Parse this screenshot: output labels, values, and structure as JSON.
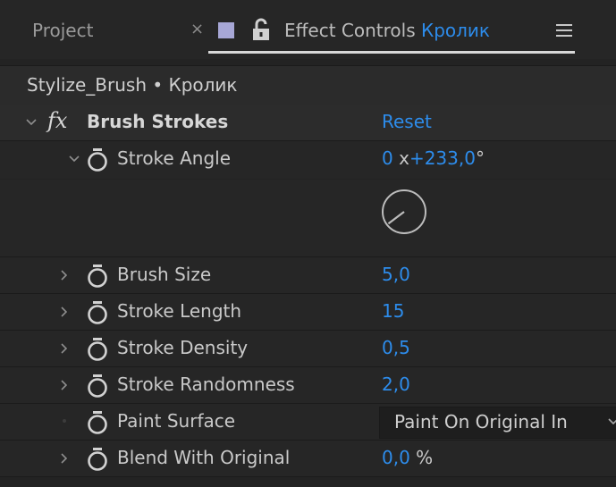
{
  "tabs": {
    "project_label": "Project",
    "close_glyph": "×",
    "effect_controls_label": "Effect Controls",
    "layer_name": "Кролик",
    "menu_icon": "hamburger-menu-icon",
    "swatch_color": "#a7a7d6"
  },
  "breadcrumb": "Stylize_Brush • Кролик",
  "effect": {
    "fx_glyph": "fx",
    "name": "Brush Strokes",
    "reset_label": "Reset"
  },
  "properties": [
    {
      "label": "Stroke Angle",
      "value": "0",
      "value_suffix": "x+233,0",
      "unit": "°",
      "expanded": true
    },
    {
      "label": "Brush Size",
      "value": "5,0",
      "unit": ""
    },
    {
      "label": "Stroke Length",
      "value": "15",
      "unit": ""
    },
    {
      "label": "Stroke Density",
      "value": "0,5",
      "unit": ""
    },
    {
      "label": "Stroke Randomness",
      "value": "2,0",
      "unit": ""
    },
    {
      "label": "Paint Surface",
      "value": "Paint On Original In",
      "unit": "",
      "type": "dropdown"
    },
    {
      "label": "Blend With Original",
      "value": "0,0",
      "unit": "%"
    }
  ],
  "angle_degrees": 233,
  "colors": {
    "accent": "#2d8ceb",
    "panel_bg": "#262626",
    "text": "#c9c9c9"
  }
}
